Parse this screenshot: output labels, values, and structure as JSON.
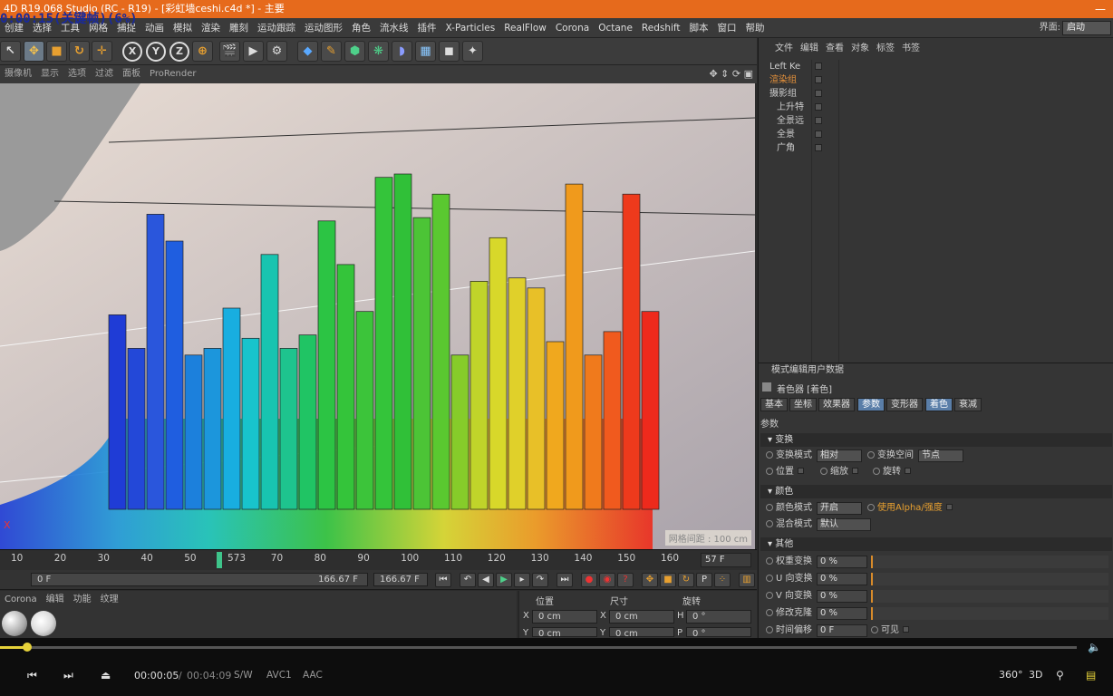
{
  "window": {
    "title": "4D R19.068 Studio (RC - R19) - [彩虹墙ceshi.c4d *] - 主要",
    "close_glyph": "—"
  },
  "overlay_text": "0:00:15(关键帧)(6%)",
  "menubar": {
    "items": [
      "创建",
      "选择",
      "工具",
      "网格",
      "捕捉",
      "动画",
      "模拟",
      "渲染",
      "雕刻",
      "运动跟踪",
      "运动图形",
      "角色",
      "流水线",
      "插件",
      "X-Particles",
      "RealFlow",
      "Corona",
      "Octane",
      "Redshift",
      "脚本",
      "窗口",
      "帮助"
    ],
    "layout_label": "界面:",
    "layout_value": "启动"
  },
  "viewport": {
    "menu": [
      "摄像机",
      "显示",
      "选项",
      "过滤",
      "面板",
      "ProRender"
    ],
    "grid_label": "网格间距 : 100 cm",
    "axis_label": "X",
    "bar_heights": [
      0.58,
      0.48,
      0.88,
      0.8,
      0.46,
      0.48,
      0.6,
      0.51,
      0.76,
      0.48,
      0.52,
      0.86,
      0.73,
      0.59,
      0.99,
      1.0,
      0.87,
      0.94,
      0.46,
      0.68,
      0.81,
      0.69,
      0.66,
      0.5,
      0.97,
      0.46,
      0.53,
      0.94,
      0.59
    ]
  },
  "timeline": {
    "ticks": [
      "10",
      "20",
      "30",
      "40",
      "50",
      "573",
      "70",
      "80",
      "90",
      "100",
      "110",
      "120",
      "130",
      "140",
      "150",
      "160"
    ],
    "current_frame": "57 F",
    "start_field": "0 F",
    "end_field": "166.67 F",
    "end_field2": "166.67 F"
  },
  "material_bar": {
    "menu": [
      "Corona",
      "编辑",
      "功能",
      "纹理"
    ]
  },
  "coords": {
    "headers": [
      "位置",
      "尺寸",
      "旋转"
    ],
    "rows": [
      {
        "a": "X",
        "av": "0 cm",
        "b": "X",
        "bv": "0 cm",
        "c": "H",
        "cv": "0 °"
      },
      {
        "a": "Y",
        "av": "0 cm",
        "b": "Y",
        "bv": "0 cm",
        "c": "P",
        "cv": "0 °"
      }
    ]
  },
  "object_manager": {
    "menu": [
      "文件",
      "编辑",
      "查看",
      "对象",
      "标签",
      "书签"
    ],
    "objects": [
      {
        "name": "Left Ke",
        "color": "#cfcfcf",
        "indent": 0
      },
      {
        "name": "渲染组",
        "color": "#e8923a",
        "indent": 0
      },
      {
        "name": "摄影组",
        "color": "#cfcfcf",
        "indent": 0
      },
      {
        "name": "上升特",
        "color": "#cfcfcf",
        "indent": 1
      },
      {
        "name": "全景远",
        "color": "#cfcfcf",
        "indent": 1
      },
      {
        "name": "全景",
        "color": "#cfcfcf",
        "indent": 1
      },
      {
        "name": "广角",
        "color": "#cfcfcf",
        "indent": 1
      }
    ]
  },
  "attributes": {
    "menu": [
      "模式",
      "编辑",
      "用户数据"
    ],
    "title": "着色器 [着色]",
    "tabs": [
      "基本",
      "坐标",
      "效果器",
      "参数",
      "变形器",
      "着色",
      "衰减"
    ],
    "section_params": "参数",
    "section_transform": "变换",
    "transform_mode_label": "变换模式",
    "transform_mode_value": "相对",
    "transform_space_label": "变换空间",
    "transform_space_value": "节点",
    "pos_label": "位置",
    "scale_label": "缩放",
    "rot_label": "旋转",
    "section_color": "颜色",
    "color_mode_label": "颜色模式",
    "color_mode_value": "开启",
    "use_alpha_label": "使用Alpha/强度",
    "blend_label": "混合模式",
    "blend_value": "默认",
    "section_other": "其他",
    "weight_label": "权重变换",
    "weight_value": "0 %",
    "u_label": "U 向变换",
    "u_value": "0 %",
    "v_label": "V 向变换",
    "v_value": "0 %",
    "clip_label": "修改克隆",
    "clip_value": "0 %",
    "time_label": "时间偏移",
    "time_value": "0 F",
    "visible_label": "可见"
  },
  "player": {
    "current_time": "00:00:05",
    "separator": "/",
    "total_time": "00:04:09",
    "badges": [
      "S/W",
      "AVC1",
      "AAC"
    ],
    "right_icons": [
      "360°",
      "3D"
    ],
    "progress": 0.025,
    "accent": "#e6d23a"
  }
}
